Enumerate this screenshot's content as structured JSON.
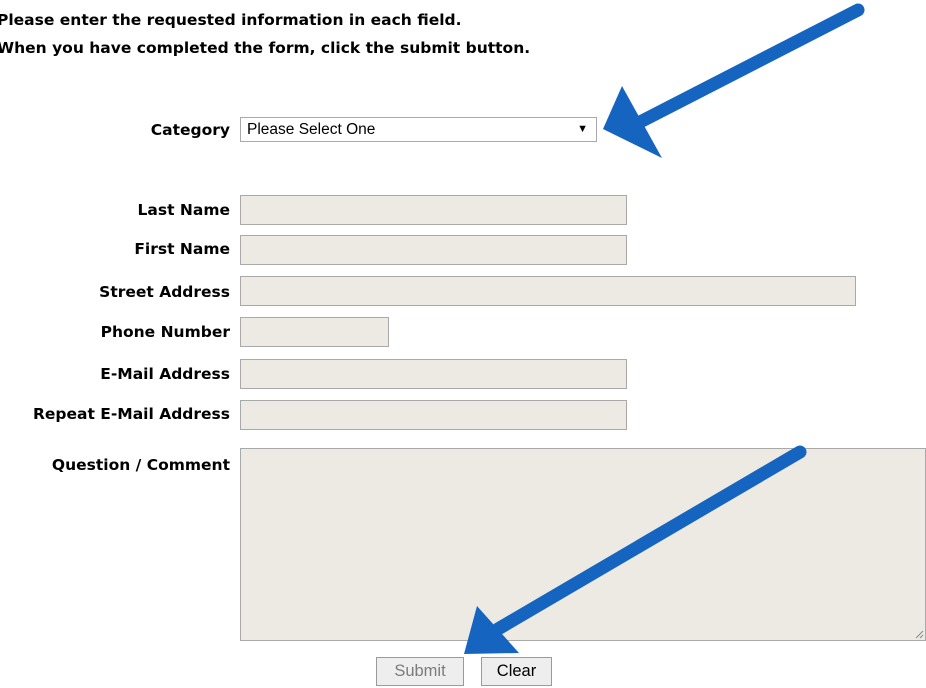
{
  "instructions": [
    "Please enter the requested information in each field.",
    "When you have completed the form, click the submit button."
  ],
  "category": {
    "label": "Category",
    "selected": "Please Select One"
  },
  "fields": {
    "last_name": "Last Name",
    "first_name": "First Name",
    "street_address": "Street Address",
    "phone_number": "Phone Number",
    "email": "E-Mail Address",
    "repeat_email": "Repeat E-Mail Address",
    "comment": "Question / Comment"
  },
  "buttons": {
    "submit": "Submit",
    "clear": "Clear"
  },
  "colors": {
    "arrow": "#1565c0",
    "field_bg": "#eceae3",
    "border": "#a9a9a9"
  },
  "icons": [
    "dropdown-caret-icon",
    "resize-handle-icon",
    "arrow-annotation-icon"
  ]
}
